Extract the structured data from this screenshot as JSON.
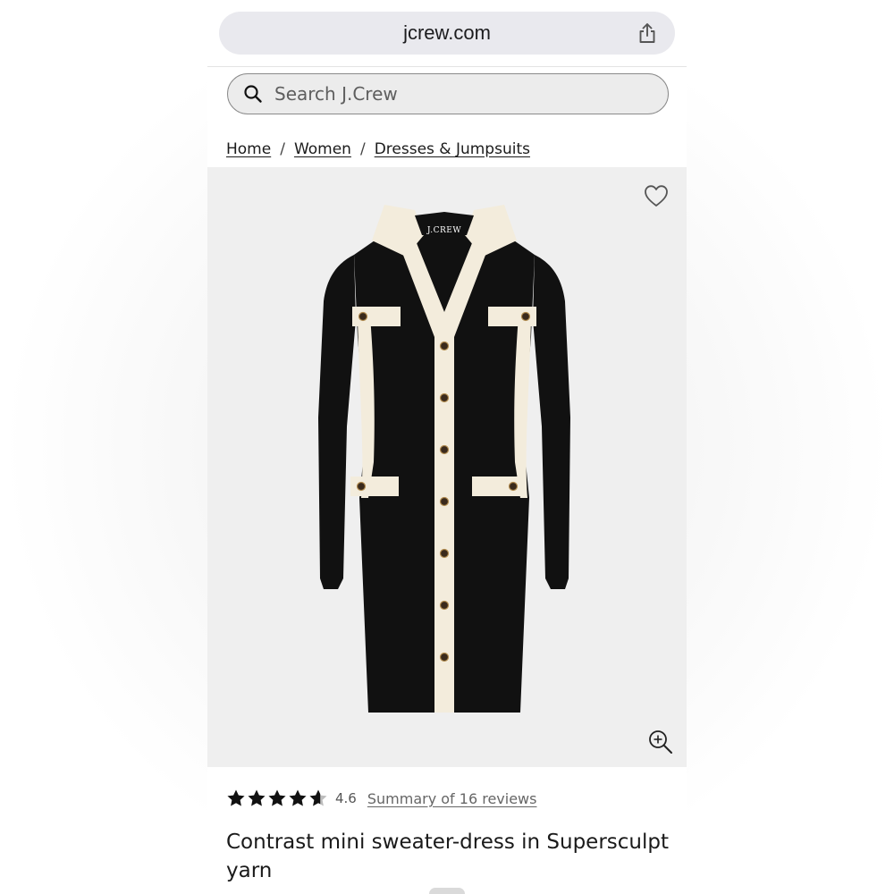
{
  "browser": {
    "url": "jcrew.com"
  },
  "search": {
    "placeholder": "Search J.Crew"
  },
  "breadcrumb": {
    "items": [
      "Home",
      "Women",
      "Dresses & Jumpsuits"
    ],
    "separator": "/"
  },
  "product": {
    "image_label": "J.CREW",
    "rating": {
      "value": "4.6",
      "stars": 4.6,
      "reviews_link": "Summary of 16 reviews"
    },
    "title": "Contrast mini sweater-dress in Supersculpt yarn"
  },
  "icons": {
    "share": "share-icon",
    "search": "search-icon",
    "favorite": "heart-icon",
    "zoom": "zoom-in-icon",
    "star": "star-icon"
  },
  "colors": {
    "dress_body": "#111111",
    "dress_trim": "#f3ecdc",
    "image_background": "#efefef",
    "url_bar": "#e9e9ee"
  }
}
